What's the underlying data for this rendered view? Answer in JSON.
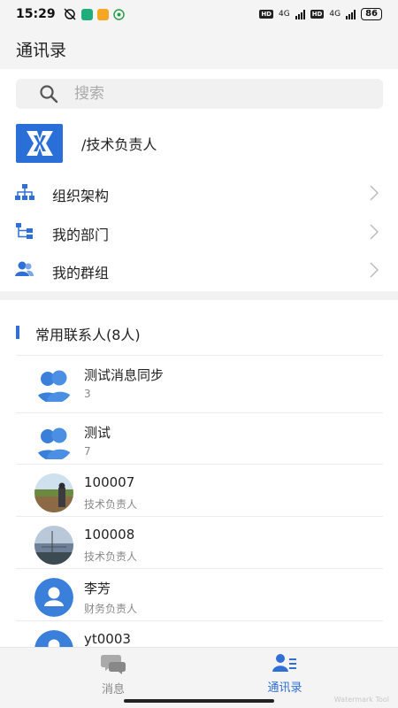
{
  "status_bar": {
    "time": "15:29",
    "signal1": "4G",
    "signal2": "4G",
    "hd1": "HD",
    "hd2": "HD",
    "battery": "86"
  },
  "header": {
    "title": "通讯录"
  },
  "search": {
    "placeholder": "搜索"
  },
  "profile": {
    "name": "/技术负责人"
  },
  "menu": [
    {
      "label": "组织架构",
      "icon": "org-chart-icon"
    },
    {
      "label": "我的部门",
      "icon": "department-icon"
    },
    {
      "label": "我的群组",
      "icon": "group-icon"
    }
  ],
  "frequent": {
    "title": "常用联系人(8人)",
    "contacts": [
      {
        "name": "测试消息同步",
        "sub": "3",
        "avatar": "group-avatar-icon"
      },
      {
        "name": "测试",
        "sub": "7",
        "avatar": "group-avatar-icon"
      },
      {
        "name": "100007",
        "sub": "技术负责人",
        "avatar": "photo-avatar"
      },
      {
        "name": "100008",
        "sub": "技术负责人",
        "avatar": "photo-avatar"
      },
      {
        "name": "李芳",
        "sub": "财务负责人",
        "avatar": "person-avatar-icon"
      },
      {
        "name": "yt0003",
        "sub": "",
        "avatar": "person-avatar-icon"
      }
    ]
  },
  "bottom_nav": {
    "messages": "消息",
    "contacts": "通讯录"
  },
  "watermark": "Watermark Tool",
  "colors": {
    "accent": "#2f6fd6",
    "header_bg": "#f4f4f4"
  }
}
